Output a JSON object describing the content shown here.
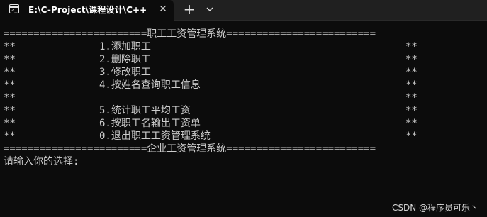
{
  "window": {
    "tab_title": "E:\\C-Project\\课程设计\\C++课",
    "close_glyph": "✕",
    "new_tab_glyph": "+",
    "dropdown_icon": "chevron-down-icon",
    "tab_icon": "terminal-icon"
  },
  "console": {
    "header_line": "========================职工工资管理系统=========================",
    "footer_line": "========================企业工资管理系统=========================",
    "stars": "**",
    "menu_items": [
      "1.添加职工",
      "2.删除职工",
      "3.修改职工",
      "4.按姓名查询职工信息",
      "",
      "5.统计职工平均工资",
      "6.按职工名输出工资单",
      "0.退出职工工资管理系统"
    ],
    "prompt": "请输入你的选择:"
  },
  "watermark": "CSDN @程序员可乐丶"
}
